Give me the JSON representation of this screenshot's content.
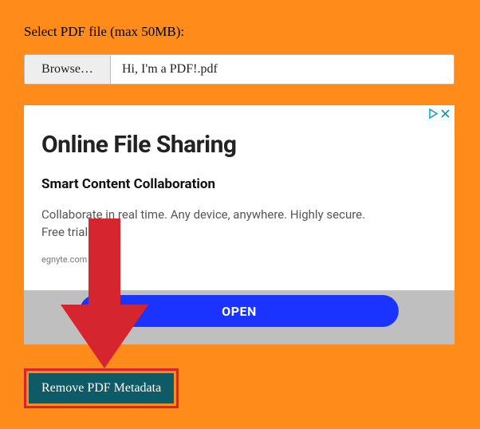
{
  "form": {
    "label": "Select PDF file (max 50MB):",
    "browse_label": "Browse…",
    "filename": "Hi, I'm a PDF!.pdf"
  },
  "ad": {
    "title": "Online File Sharing",
    "subtitle": "Smart Content Collaboration",
    "description_line1": "Collaborate in real time. Any device, anywhere. Highly secure.",
    "description_line2": "Free trial!",
    "domain": "egnyte.com",
    "cta": "OPEN"
  },
  "action": {
    "remove_label": "Remove PDF Metadata"
  },
  "colors": {
    "page_bg": "#ff8c1a",
    "action_bg": "#0e5a66",
    "highlight": "#d5262f",
    "ad_cta": "#1a33ff",
    "ad_tray": "#bfbfbf"
  }
}
